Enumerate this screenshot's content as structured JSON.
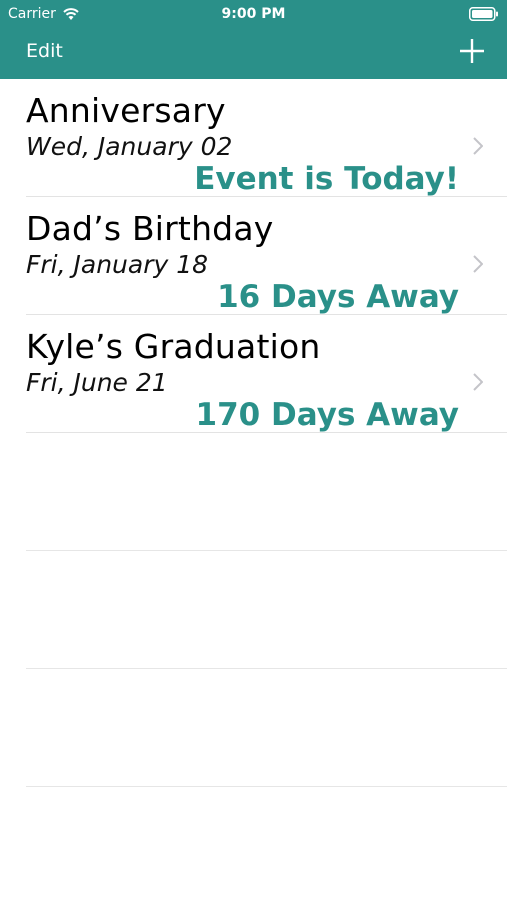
{
  "status_bar": {
    "carrier": "Carrier",
    "time": "9:00 PM"
  },
  "nav": {
    "edit_label": "Edit",
    "add_icon": "plus-icon"
  },
  "events": [
    {
      "title": "Anniversary",
      "date": "Wed, January 02",
      "status": "Event is Today!"
    },
    {
      "title": "Dad’s Birthday",
      "date": "Fri, January 18",
      "status": "16 Days Away"
    },
    {
      "title": "Kyle’s Graduation",
      "date": "Fri, June 21",
      "status": "170 Days Away"
    }
  ],
  "colors": {
    "accent": "#2a9089",
    "separator": "#e3e3e3"
  }
}
